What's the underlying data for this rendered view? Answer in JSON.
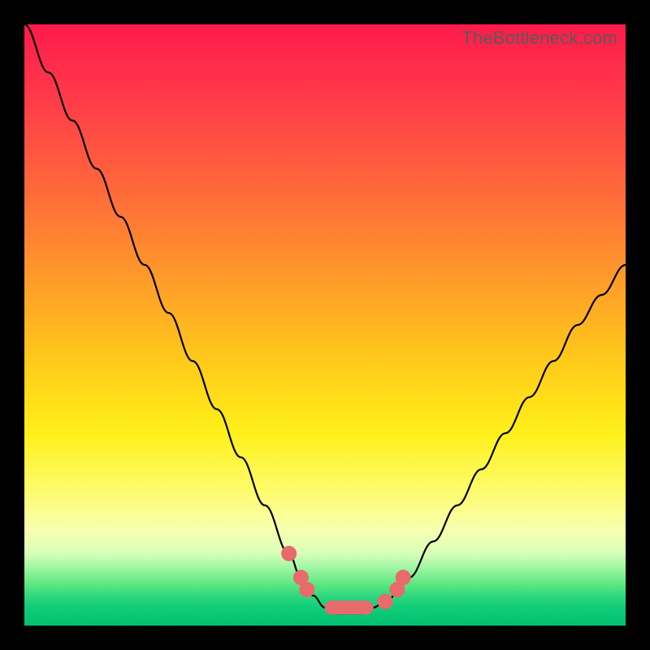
{
  "watermark": "TheBottleneck.com",
  "colors": {
    "background": "#000000",
    "curve": "#000000",
    "marker": "#e86a6a"
  },
  "chart_data": {
    "type": "line",
    "title": "",
    "xlabel": "",
    "ylabel": "",
    "xlim": [
      0,
      100
    ],
    "ylim": [
      0,
      100
    ],
    "grid": false,
    "legend": false,
    "series": [
      {
        "name": "bottleneck-curve",
        "x": [
          0,
          4,
          8,
          12,
          16,
          20,
          24,
          28,
          32,
          36,
          40,
          44,
          46,
          48,
          50,
          52,
          54,
          56,
          58,
          60,
          64,
          68,
          72,
          76,
          80,
          84,
          88,
          92,
          96,
          100
        ],
        "values": [
          100,
          92,
          84,
          76,
          68,
          60,
          52,
          44,
          36,
          28,
          20,
          12,
          8,
          5,
          3,
          2,
          2,
          2,
          3,
          4,
          8,
          14,
          20,
          26,
          32,
          38,
          44,
          50,
          55,
          60
        ]
      }
    ],
    "markers": [
      {
        "x": 44,
        "y": 12
      },
      {
        "x": 46,
        "y": 8
      },
      {
        "x": 47,
        "y": 6
      },
      {
        "x": 50,
        "y": 3,
        "pill_to_x": 58
      },
      {
        "x": 60,
        "y": 4
      },
      {
        "x": 62,
        "y": 6
      },
      {
        "x": 63,
        "y": 8
      }
    ],
    "gradient_stops": [
      {
        "pos": 0.0,
        "color": "#ff1a4a"
      },
      {
        "pos": 0.12,
        "color": "#ff3a4a"
      },
      {
        "pos": 0.28,
        "color": "#ff6a3a"
      },
      {
        "pos": 0.42,
        "color": "#ff9a2a"
      },
      {
        "pos": 0.56,
        "color": "#ffca1a"
      },
      {
        "pos": 0.68,
        "color": "#fff01a"
      },
      {
        "pos": 0.78,
        "color": "#fefc70"
      },
      {
        "pos": 0.84,
        "color": "#f8ffb0"
      },
      {
        "pos": 0.88,
        "color": "#d8ffb8"
      },
      {
        "pos": 0.9,
        "color": "#a8f8a8"
      },
      {
        "pos": 0.93,
        "color": "#60e880"
      },
      {
        "pos": 0.95,
        "color": "#30d880"
      },
      {
        "pos": 0.97,
        "color": "#10cc78"
      },
      {
        "pos": 1.0,
        "color": "#00c070"
      }
    ]
  }
}
